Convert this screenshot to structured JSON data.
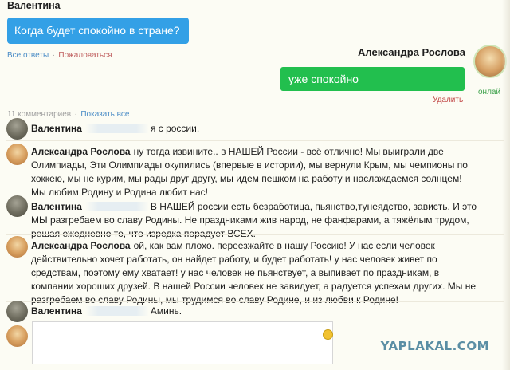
{
  "question": {
    "author": "Валентина",
    "text": "Когда будет спокойно в стране?",
    "link_all_answers": "Все ответы",
    "separator": "·",
    "link_report": "Пожаловаться"
  },
  "answer": {
    "author": "Александра Рослова",
    "text": "уже спокойно",
    "delete_link": "Удалить",
    "status": "онлай"
  },
  "comments_meta": {
    "count_label": "11 комментариев",
    "separator": "·",
    "show_all": "Показать все"
  },
  "comments": [
    {
      "author": "Валентина",
      "text": "я с россии."
    },
    {
      "author": "Александра Рослова",
      "text": "ну тогда извините.. в НАШЕЙ России - всё отлично! Мы выиграли две Олимпиады, Эти Олимпиады окупились (впервые в истории), мы вернули Крым, мы чемпионы по хоккею, мы не курим, мы рады друг другу, мы идем пешком на работу и наслаждаемся солнцем! Мы любим Родину и Родина любит нас!"
    },
    {
      "author": "Валентина",
      "text": "В НАШЕЙ россии есть безработица, пьянство,тунеядство, зависть. И это МЫ разгребаем во славу Родины. Не праздниками жив народ, не фанфарами, а тяжёлым трудом, решая ежедневно то, что изредка порадует ВСЕХ."
    },
    {
      "author": "Александра Рослова",
      "text": "ой, как вам плохо. переезжайте в нашу Россию! У нас если человек действительно хочет работать, он найдет работу, и будет работать! у нас человек живет по средствам, поэтому ему хватает! у нас человек не пьянствует, а выпивает по праздникам, в компании хороших друзей. В нашей России человек не завидует, а радуется успехам других. Мы не разгребаем во славу Родины, мы трудимся во славу Родине, и из любви к Родине!"
    },
    {
      "author": "Валентина",
      "text": "Аминь."
    }
  ],
  "reply": {
    "value": ""
  },
  "watermark": "YAPLAKAL.COM",
  "colors": {
    "question_bubble": "#33a0e6",
    "answer_bubble": "#22bf4e",
    "link": "#4a8cc6",
    "delete_link": "#c04444"
  }
}
